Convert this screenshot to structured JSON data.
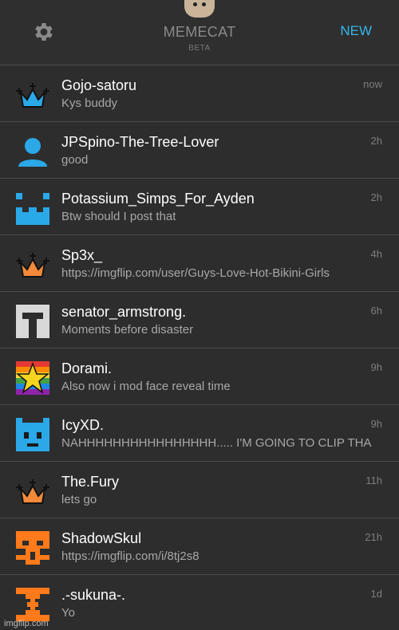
{
  "header": {
    "gear_icon": "gear-icon",
    "title": "MEMECAT",
    "subtitle": "BETA",
    "new_label": "NEW"
  },
  "colors": {
    "accent": "#35b6ea",
    "background": "#2b2b2b",
    "crown_blue": "#2aa8e8",
    "crown_orange": "#f28a3a",
    "avatar_orange": "#ff7a1a"
  },
  "messages": [
    {
      "name": "Gojo-satoru",
      "text": "Kys buddy",
      "time": "now",
      "avatar": "crown-blue"
    },
    {
      "name": "JPSpino-The-Tree-Lover",
      "text": "good",
      "time": "2h",
      "avatar": "person-blue"
    },
    {
      "name": "Potassium_Simps_For_Ayden",
      "text": "Btw should I post that",
      "time": "2h",
      "avatar": "blocky-blue"
    },
    {
      "name": "Sp3x_",
      "text": "https://imgflip.com/user/Guys-Love-Hot-Bikini-Girls",
      "time": "4h",
      "avatar": "crown-orange"
    },
    {
      "name": "senator_armstrong.",
      "text": "Moments before disaster",
      "time": "6h",
      "avatar": "blocky-gray"
    },
    {
      "name": "Dorami.",
      "text": "Also now i mod face reveal time",
      "time": "9h",
      "avatar": "star-rainbow"
    },
    {
      "name": "IcyXD.",
      "text": "NAHHHHHHHHHHHHHHHH..... I'M GOING TO CLIP THA",
      "time": "9h",
      "avatar": "blocky-blue-face"
    },
    {
      "name": "The.Fury",
      "text": "lets go",
      "time": "11h",
      "avatar": "crown-orange"
    },
    {
      "name": "ShadowSkul",
      "text": "https://imgflip.com/i/8tj2s8",
      "time": "21h",
      "avatar": "blocky-orange"
    },
    {
      "name": ".-sukuna-.",
      "text": "Yo",
      "time": "1d",
      "avatar": "blocky-orange-x"
    }
  ],
  "watermark": "imgflip.com"
}
